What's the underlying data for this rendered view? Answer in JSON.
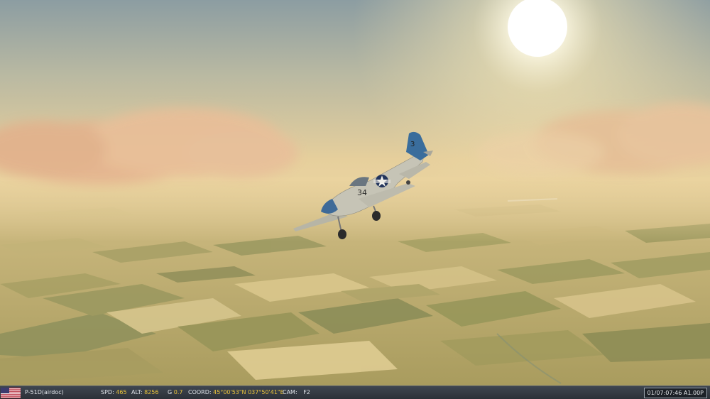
{
  "scene": {
    "aircraft": {
      "nose_number": "34",
      "tail_number": "3"
    }
  },
  "hud": {
    "flag_icon": "us-flag-icon",
    "aircraft_label": "P-51D(airdoc)",
    "speed": {
      "label": "SPD:",
      "value": "465"
    },
    "altitude": {
      "label": "ALT:",
      "value": "8256"
    },
    "g_force": {
      "label": "G",
      "value": "0.7"
    },
    "coords": {
      "label": "COORD:",
      "value": "45°00'53\"N 037°50'41\"E"
    },
    "camera": {
      "label": "CAM:",
      "value": "F2"
    },
    "clock": "01/07:07:46 A1.00P"
  },
  "colors": {
    "hud_bg": "#353b43",
    "hud_value": "#e8c23a",
    "sky_top": "#8fa0a3",
    "haze": "#e8cf9a"
  }
}
